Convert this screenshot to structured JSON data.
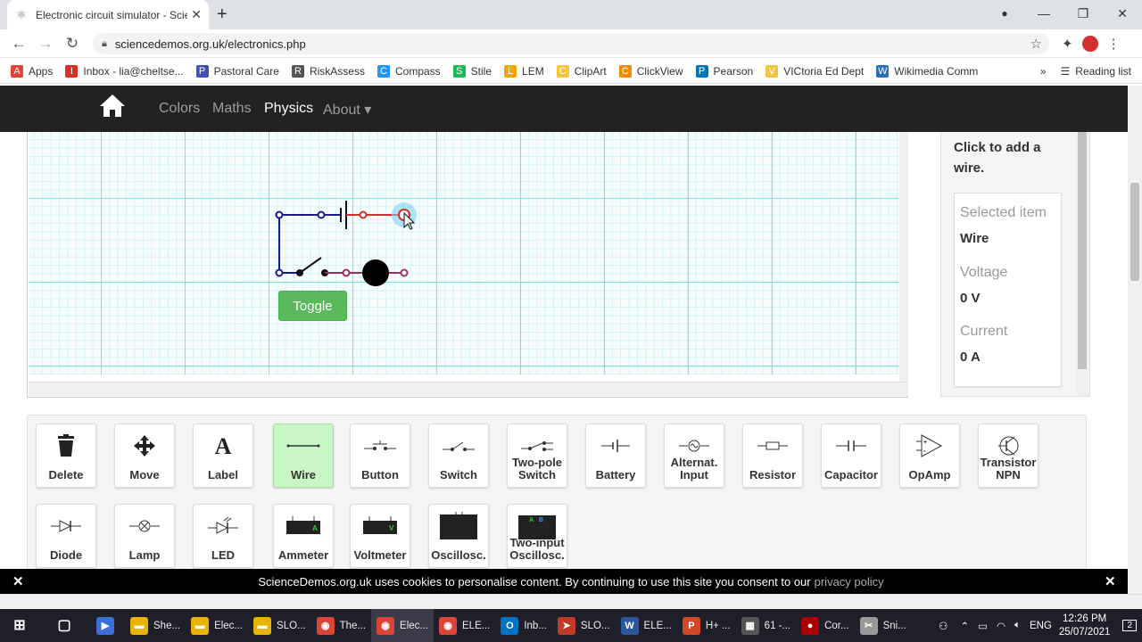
{
  "browser": {
    "tab_title": "Electronic circuit simulator - Scie",
    "tab_close": "✕",
    "new_tab": "+",
    "url": "sciencedemos.org.uk/electronics.php",
    "window_controls": [
      "—",
      "❐",
      "✕"
    ],
    "bookmarks": [
      {
        "label": "Apps",
        "icon": "apps-icon",
        "color": "#e94235"
      },
      {
        "label": "Inbox - lia@cheltse...",
        "icon": "gmail-icon",
        "color": "#d93025"
      },
      {
        "label": "Pastoral Care",
        "icon": "doc-icon",
        "color": "#3f51b5"
      },
      {
        "label": "RiskAssess",
        "icon": "r-icon",
        "color": "#555"
      },
      {
        "label": "Compass",
        "icon": "compass-icon",
        "color": "#2196f3"
      },
      {
        "label": "Stile",
        "icon": "stile-icon",
        "color": "#1db954"
      },
      {
        "label": "LEM",
        "icon": "lem-icon",
        "color": "#f0a800"
      },
      {
        "label": "ClipArt",
        "icon": "folder-icon",
        "color": "#f5c542"
      },
      {
        "label": "ClickView",
        "icon": "play-icon",
        "color": "#f08c00"
      },
      {
        "label": "Pearson",
        "icon": "pearson-icon",
        "color": "#0077b5"
      },
      {
        "label": "VICtoria Ed Dept",
        "icon": "folder-icon",
        "color": "#f5c542"
      },
      {
        "label": "Wikimedia Comm",
        "icon": "wikimedia-icon",
        "color": "#2a6ebb"
      }
    ],
    "more": "»",
    "reading_list": "Reading list"
  },
  "site": {
    "menu": [
      "Colors",
      "Maths",
      "Physics",
      "About ▾"
    ],
    "active_menu": "Physics"
  },
  "canvas": {
    "toggle_label": "Toggle"
  },
  "panel": {
    "hint": "Click to add a wire.",
    "selected_label": "Selected item",
    "selected_value": "Wire",
    "voltage_label": "Voltage",
    "voltage_value": "0 V",
    "current_label": "Current",
    "current_value": "0 A"
  },
  "tools": [
    {
      "label": "Delete",
      "icon": "trash-icon"
    },
    {
      "label": "Move",
      "icon": "move-icon"
    },
    {
      "label": "Label",
      "icon": "label-icon"
    },
    {
      "label": "Wire",
      "icon": "wire-icon",
      "selected": true
    },
    {
      "label": "Button",
      "icon": "button-icon"
    },
    {
      "label": "Switch",
      "icon": "switch-icon"
    },
    {
      "label": "Two-pole Switch",
      "icon": "two-pole-switch-icon"
    },
    {
      "label": "Battery",
      "icon": "battery-icon"
    },
    {
      "label": "Alternat. Input",
      "icon": "ac-input-icon"
    },
    {
      "label": "Resistor",
      "icon": "resistor-icon"
    },
    {
      "label": "Capacitor",
      "icon": "capacitor-icon"
    },
    {
      "label": "OpAmp",
      "icon": "opamp-icon"
    },
    {
      "label": "Transistor NPN",
      "icon": "transistor-icon"
    },
    {
      "label": "Diode",
      "icon": "diode-icon"
    },
    {
      "label": "Lamp",
      "icon": "lamp-icon"
    },
    {
      "label": "LED",
      "icon": "led-icon"
    },
    {
      "label": "Ammeter",
      "icon": "ammeter-icon",
      "badge": "A"
    },
    {
      "label": "Voltmeter",
      "icon": "voltmeter-icon",
      "badge": "V"
    },
    {
      "label": "Oscillosc.",
      "icon": "oscilloscope-icon"
    },
    {
      "label": "Two-input Oscillosc.",
      "icon": "two-input-oscilloscope-icon"
    }
  ],
  "cookie": {
    "text": "ScienceDemos.org.uk uses cookies to personalise content. By continuing to use this site you consent to our",
    "link": "privacy policy",
    "close": "✕"
  },
  "taskbar": {
    "items": [
      {
        "label": "",
        "icon": "start-icon",
        "color": "#1f1f2a"
      },
      {
        "label": "",
        "icon": "task-view-icon",
        "color": "#1f1f2a"
      },
      {
        "label": "",
        "icon": "media-icon",
        "color": "#3a6fd8"
      },
      {
        "label": "She...",
        "icon": "folder-icon",
        "color": "#e8b400"
      },
      {
        "label": "Elec...",
        "icon": "folder-icon",
        "color": "#e8b400"
      },
      {
        "label": "SLO...",
        "icon": "folder-icon",
        "color": "#e8b400"
      },
      {
        "label": "The...",
        "icon": "chrome-icon",
        "color": "#db4437"
      },
      {
        "label": "Elec...",
        "icon": "chrome-icon",
        "color": "#db4437",
        "active": true
      },
      {
        "label": "ELE...",
        "icon": "chrome-icon",
        "color": "#db4437"
      },
      {
        "label": "Inb...",
        "icon": "outlook-icon",
        "color": "#0072c6"
      },
      {
        "label": "SLO...",
        "icon": "arrow-icon",
        "color": "#c0392b"
      },
      {
        "label": "ELE...",
        "icon": "word-icon",
        "color": "#2b579a"
      },
      {
        "label": "H+ ...",
        "icon": "powerpoint-icon",
        "color": "#d24726"
      },
      {
        "label": "61 -...",
        "icon": "calculator-icon",
        "color": "#555"
      },
      {
        "label": "Cor...",
        "icon": "recorder-icon",
        "color": "#a00"
      },
      {
        "label": "Sni...",
        "icon": "snip-icon",
        "color": "#999"
      }
    ],
    "lang": "ENG",
    "time": "12:26 PM",
    "date": "25/07/2021",
    "notif": "2"
  }
}
